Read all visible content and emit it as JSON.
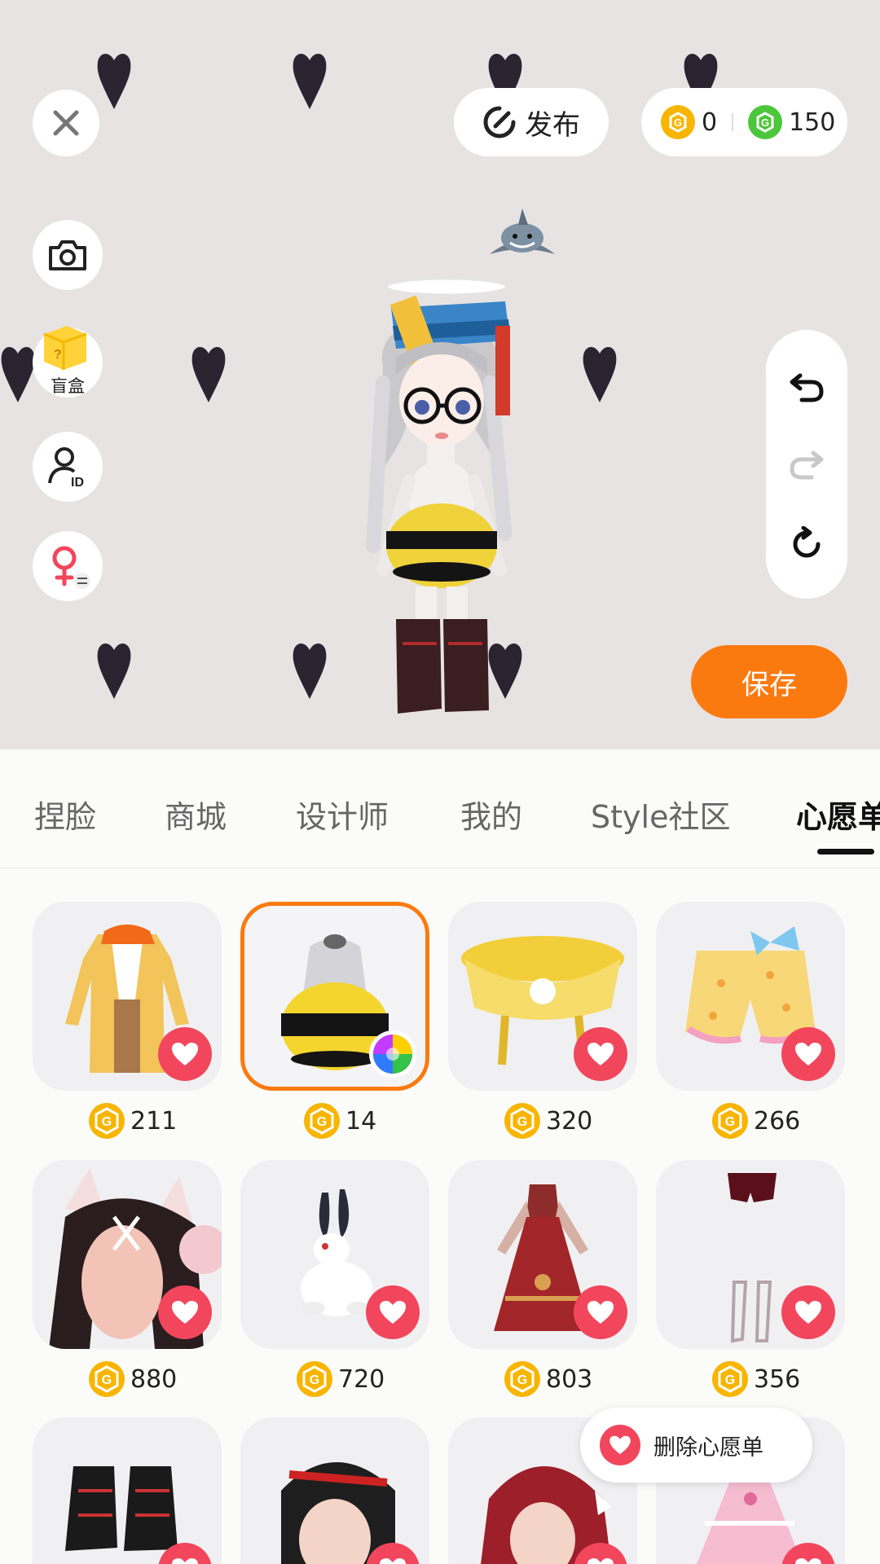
{
  "toolbar": {
    "publish_label": "发布"
  },
  "currency": {
    "gold": "0",
    "green": "150"
  },
  "side": {
    "blindbox_label": "盲盒"
  },
  "save_label": "保存",
  "tabs": [
    {
      "label": "捏脸",
      "active": false
    },
    {
      "label": "商城",
      "active": false
    },
    {
      "label": "设计师",
      "active": false
    },
    {
      "label": "我的",
      "active": false
    },
    {
      "label": "Style社区",
      "active": false
    },
    {
      "label": "心愿单",
      "active": true
    }
  ],
  "items": [
    {
      "name": "yellow-coat",
      "price": "211"
    },
    {
      "name": "bee-top",
      "price": "14",
      "selected": true
    },
    {
      "name": "yellow-skirt",
      "price": "320"
    },
    {
      "name": "polka-shorts",
      "price": "266"
    },
    {
      "name": "cat-ear-hair",
      "price": "880"
    },
    {
      "name": "rabbit-pet",
      "price": "720"
    },
    {
      "name": "red-dress",
      "price": "803"
    },
    {
      "name": "stockings",
      "price": "356"
    },
    {
      "name": "boots",
      "price": ""
    },
    {
      "name": "black-hair",
      "price": ""
    },
    {
      "name": "red-hair",
      "price": ""
    },
    {
      "name": "pink-dress",
      "price": ""
    }
  ],
  "toast": {
    "label": "删除心愿单"
  },
  "colors": {
    "accent": "#fb7a10",
    "favorite": "#f2465c",
    "coin_gold": "#f7b500",
    "coin_green": "#4cc63a"
  }
}
